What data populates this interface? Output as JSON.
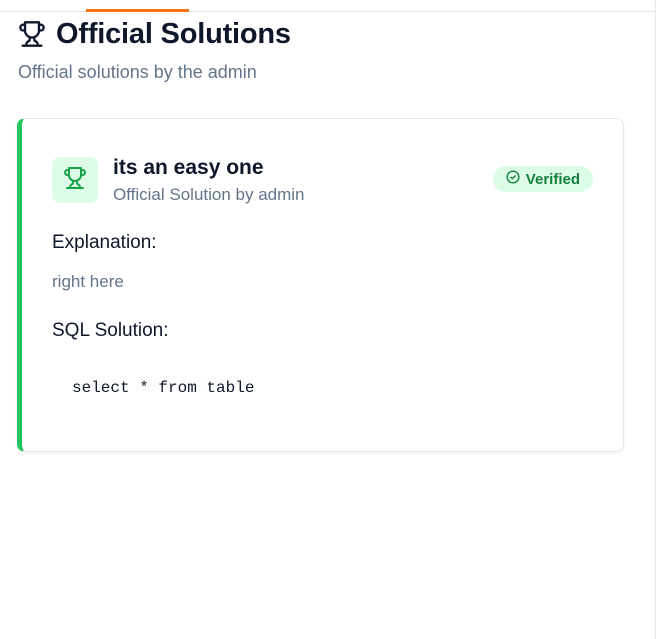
{
  "header": {
    "title": "Official Solutions",
    "subtitle": "Official solutions by the admin",
    "icon": "trophy-icon"
  },
  "solution": {
    "title": "its an easy one",
    "byline": "Official Solution by admin",
    "badge": "Verified",
    "explanation_label": "Explanation:",
    "explanation_text": "right here",
    "sql_label": "SQL Solution:",
    "sql_code": "select * from table"
  },
  "colors": {
    "accent_tab": "#f97316",
    "card_accent": "#22c55e",
    "badge_bg": "#dcfce7",
    "badge_text": "#15803d",
    "muted_text": "#64748b",
    "heading_text": "#0f172a"
  }
}
